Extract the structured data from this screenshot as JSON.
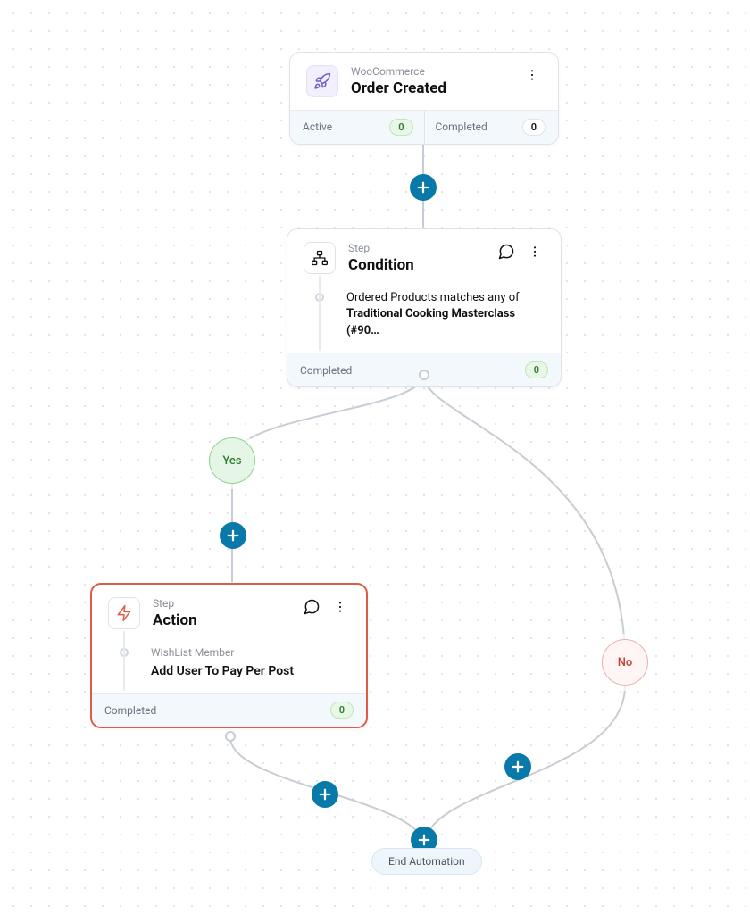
{
  "trigger": {
    "eyebrow": "WooCommerce",
    "title": "Order Created",
    "active_label": "Active",
    "active_count": "0",
    "completed_label": "Completed",
    "completed_count": "0"
  },
  "condition": {
    "eyebrow": "Step",
    "title": "Condition",
    "text_pre": "Ordered Products matches any of ",
    "text_bold": "Traditional Cooking Masterclass (#90…",
    "completed_label": "Completed",
    "completed_count": "0"
  },
  "branches": {
    "yes_label": "Yes",
    "no_label": "No"
  },
  "action": {
    "eyebrow": "Step",
    "title": "Action",
    "sublabel": "WishList Member",
    "subtitle": "Add User To Pay Per Post",
    "completed_label": "Completed",
    "completed_count": "0"
  },
  "end": {
    "label": "End Automation"
  }
}
